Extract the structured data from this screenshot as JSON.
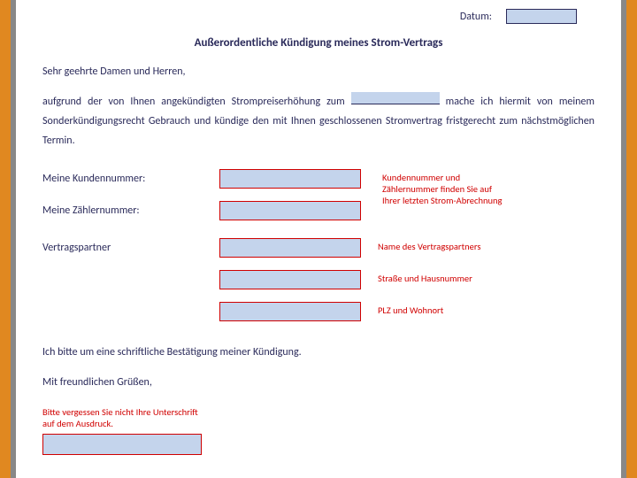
{
  "header": {
    "date_label": "Datum:"
  },
  "title": "Außerordentliche Kündigung meines Strom-Vertrags",
  "salutation": "Sehr geehrte Damen und Herren,",
  "body": {
    "part1": "aufgrund der von Ihnen angekündigten Strompreiserhöhung zum ",
    "part2": " mache ich hiermit von meinem Sonderkündigungsrecht Gebrauch und kündige den mit Ihnen geschlossenen Stromvertrag fristgerecht zum nächstmöglichen Termin."
  },
  "fields": {
    "kundennummer_label": "Meine Kundennummer:",
    "zaehlernummer_label": "Meine Zählernummer:",
    "vertragspartner_label": "Vertragspartner"
  },
  "hints": {
    "kunden_zaehler": "Kundennummer und Zählernummer finden Sie auf Ihrer letzten Strom-Abrechnung",
    "vertragspartner_name": "Name des Vertragspartners",
    "strasse": "Straße und Hausnummer",
    "plz": "PLZ und Wohnort",
    "signature": "Bitte vergessen Sie nicht Ihre Unterschrift auf dem Ausdruck."
  },
  "confirm": "Ich bitte um eine schriftliche Bestätigung meiner Kündigung.",
  "closing": "Mit freundlichen Grüßen,",
  "colors": {
    "accent_red": "#d00000",
    "field_bg": "#c4d4ec",
    "frame_orange": "#e08820"
  }
}
